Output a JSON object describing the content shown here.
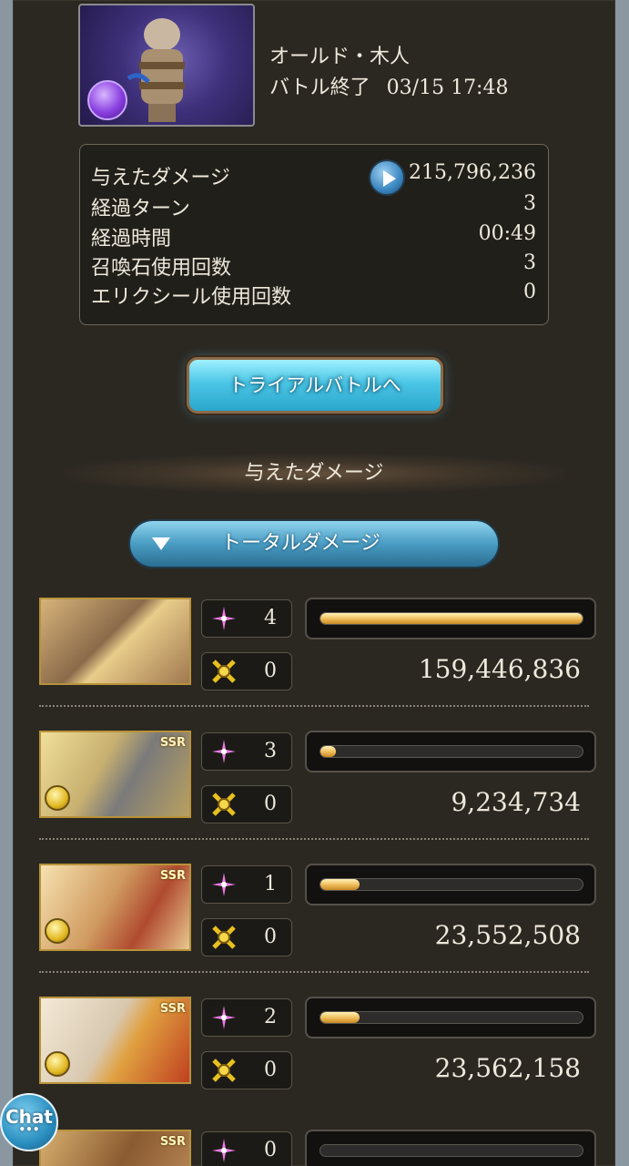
{
  "boss": {
    "name": "オールド・木人",
    "status": "バトル終了",
    "datetime": "03/15 17:48"
  },
  "stats": [
    {
      "label": "与えたダメージ",
      "value": "215,796,236"
    },
    {
      "label": "経過ターン",
      "value": "3"
    },
    {
      "label": "経過時間",
      "value": "00:49"
    },
    {
      "label": "召喚石使用回数",
      "value": "3"
    },
    {
      "label": "エリクシール使用回数",
      "value": "0"
    }
  ],
  "trial_button_label": "トライアルバトルへ",
  "section_title": "与えたダメージ",
  "dropdown": {
    "selected": "トータルダメージ"
  },
  "characters": [
    {
      "ssr": "",
      "skill_count": "4",
      "ca_count": "0",
      "damage": "159,446,836",
      "bar_percent": 100
    },
    {
      "ssr": "SSR",
      "skill_count": "3",
      "ca_count": "0",
      "damage": "9,234,734",
      "bar_percent": 6
    },
    {
      "ssr": "SSR",
      "skill_count": "1",
      "ca_count": "0",
      "damage": "23,552,508",
      "bar_percent": 15
    },
    {
      "ssr": "SSR",
      "skill_count": "2",
      "ca_count": "0",
      "damage": "23,562,158",
      "bar_percent": 15
    },
    {
      "ssr": "SSR",
      "skill_count": "0",
      "ca_count": "",
      "damage": "",
      "bar_percent": 0
    }
  ],
  "chat_label": "Chat",
  "chat_dots": "•••",
  "colors": {
    "panel_bg": "#2b2822",
    "text": "#efe9dc",
    "bar_fill": "#f0c060",
    "button_blue": "#4bc6e6"
  }
}
